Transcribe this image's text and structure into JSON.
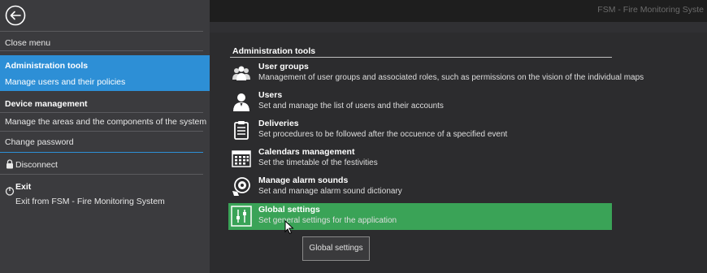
{
  "app": {
    "title": "FSM - Fire Monitoring Syste"
  },
  "sidebar": {
    "close_menu": "Close menu",
    "admin": {
      "title": "Administration tools",
      "desc": "Manage users and their policies"
    },
    "device": {
      "title": "Device management",
      "desc": "Manage the areas and the components of the system"
    },
    "change_password": "Change password",
    "disconnect": "Disconnect",
    "exit": {
      "title": "Exit",
      "desc": "Exit from FSM - Fire Monitoring System"
    }
  },
  "main": {
    "section_title": "Administration tools",
    "tools": [
      {
        "title": "User groups",
        "desc": "Management of user groups and associated roles, such as permissions on the vision of the individual maps",
        "icon": "user-groups-icon"
      },
      {
        "title": "Users",
        "desc": "Set and manage the list of users and their accounts",
        "icon": "user-icon"
      },
      {
        "title": "Deliveries",
        "desc": "Set procedures to be followed after the occuence of a specified event",
        "icon": "clipboard-icon"
      },
      {
        "title": "Calendars management",
        "desc": "Set the timetable of the festivities",
        "icon": "calendar-icon"
      },
      {
        "title": "Manage alarm sounds",
        "desc": "Set and manage alarm sound dictionary",
        "icon": "alarm-sound-icon"
      },
      {
        "title": "Global settings",
        "desc": "Set general settings for the application",
        "icon": "sliders-icon"
      }
    ],
    "tooltip": "Global settings"
  },
  "colors": {
    "active_menu": "#2d8fd6",
    "active_tool": "#3aa357"
  }
}
